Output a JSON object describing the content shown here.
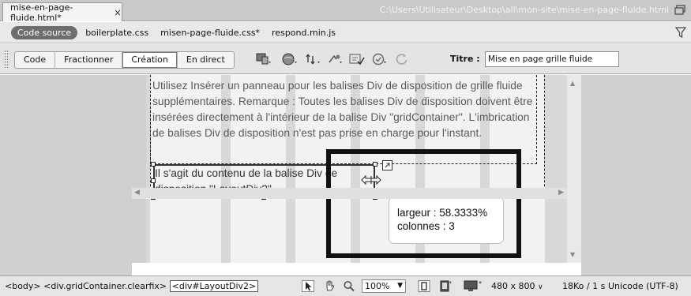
{
  "tabbar": {
    "tab_title": "mise-en-page-fluide.html*",
    "close_glyph": "×",
    "file_path": "C:\\Users\\Utilisateur\\Desktop\\all\\mon-site\\mise-en-page-fluide.html",
    "restore_icon": "window-restore-icon"
  },
  "related_files": {
    "source_label": "Code source",
    "files": [
      "boilerplate.css",
      "misen-page-fluide.css*",
      "respond.min.js"
    ],
    "filter_icon": "filter-icon"
  },
  "toolbar": {
    "view_buttons": [
      "Code",
      "Fractionner",
      "Création",
      "En direct"
    ],
    "active_view": "Création",
    "icons": [
      "multiscreen-icon",
      "browser-preview-icon",
      "file-management-icon",
      "visual-aids-icon",
      "validate-markup-icon",
      "check-browser-icon",
      "refresh-icon"
    ],
    "title_label": "Titre :",
    "title_value": "Mise en page grille fluide"
  },
  "design": {
    "paragraph1": "Utilisez Insérer un panneau pour les balises Div de disposition de grille fluide supplémentaires. Remarque : Toutes les balises Div de disposition doivent être insérées directement à l'intérieur de la balise Div \"gridContainer\". L'imbrication de balises Div de disposition n'est pas prise en charge pour l'instant.",
    "paragraph2": "Il s'agit du contenu de la balise Div de disposition \"LayoutDiv2\"",
    "tooltip_width": "largeur : 58.3333%",
    "tooltip_columns": "colonnes : 3"
  },
  "statusbar": {
    "tag_body": "<body>",
    "tag_container": "<div.gridContainer.clearfix>",
    "tag_current": "<div#LayoutDiv2>",
    "zoom": "100%",
    "window_size": "480 x 800",
    "file_size": "18Ko / 1 s",
    "encoding": "Unicode (UTF-8)"
  }
}
